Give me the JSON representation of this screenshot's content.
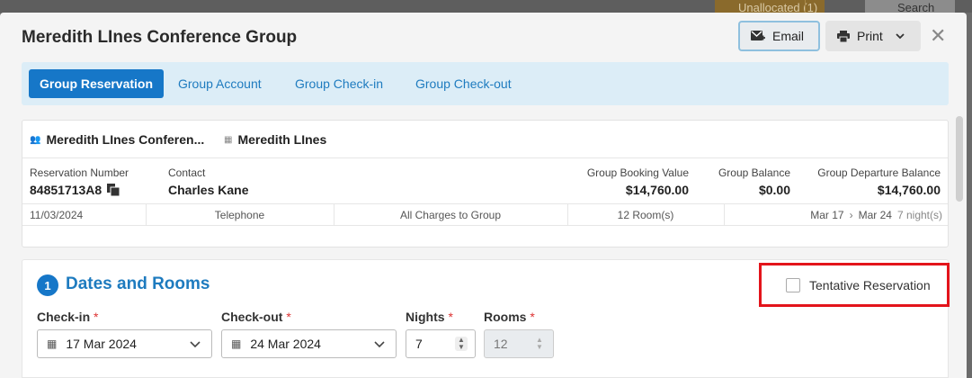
{
  "background": {
    "unallocated_label": "Unallocated (1)",
    "search_label": "Search"
  },
  "header": {
    "title": "Meredith LInes Conference Group",
    "email_label": "Email",
    "print_label": "Print"
  },
  "tabs": [
    {
      "label": "Group Reservation",
      "active": true
    },
    {
      "label": "Group Account",
      "active": false
    },
    {
      "label": "Group Check-in",
      "active": false
    },
    {
      "label": "Group Check-out",
      "active": false
    }
  ],
  "summary": {
    "group_name": "Meredith LInes Conferen...",
    "company": "Meredith LInes",
    "reservation_number_label": "Reservation Number",
    "reservation_number": "84851713A8",
    "contact_label": "Contact",
    "contact": "Charles Kane",
    "booking_value_label": "Group Booking Value",
    "booking_value": "$14,760.00",
    "balance_label": "Group Balance",
    "balance": "$0.00",
    "departure_balance_label": "Group Departure Balance",
    "departure_balance": "$14,760.00",
    "date": "11/03/2024",
    "source": "Telephone",
    "billing": "All Charges to Group",
    "rooms": "12 Room(s)",
    "arrive": "Mar 17",
    "depart": "Mar 24",
    "nights_text": "7 night(s)"
  },
  "dates_rooms": {
    "step": "1",
    "title": "Dates and Rooms",
    "tentative_label": "Tentative Reservation",
    "checkin_label": "Check-in",
    "checkin_value": "17 Mar 2024",
    "checkout_label": "Check-out",
    "checkout_value": "24 Mar 2024",
    "nights_label": "Nights",
    "nights_value": "7",
    "rooms_label": "Rooms",
    "rooms_value": "12",
    "required_mark": "*"
  },
  "colors": {
    "primary": "#1677c8",
    "highlight": "#e3141b",
    "tab_bar": "#dcedf7"
  }
}
